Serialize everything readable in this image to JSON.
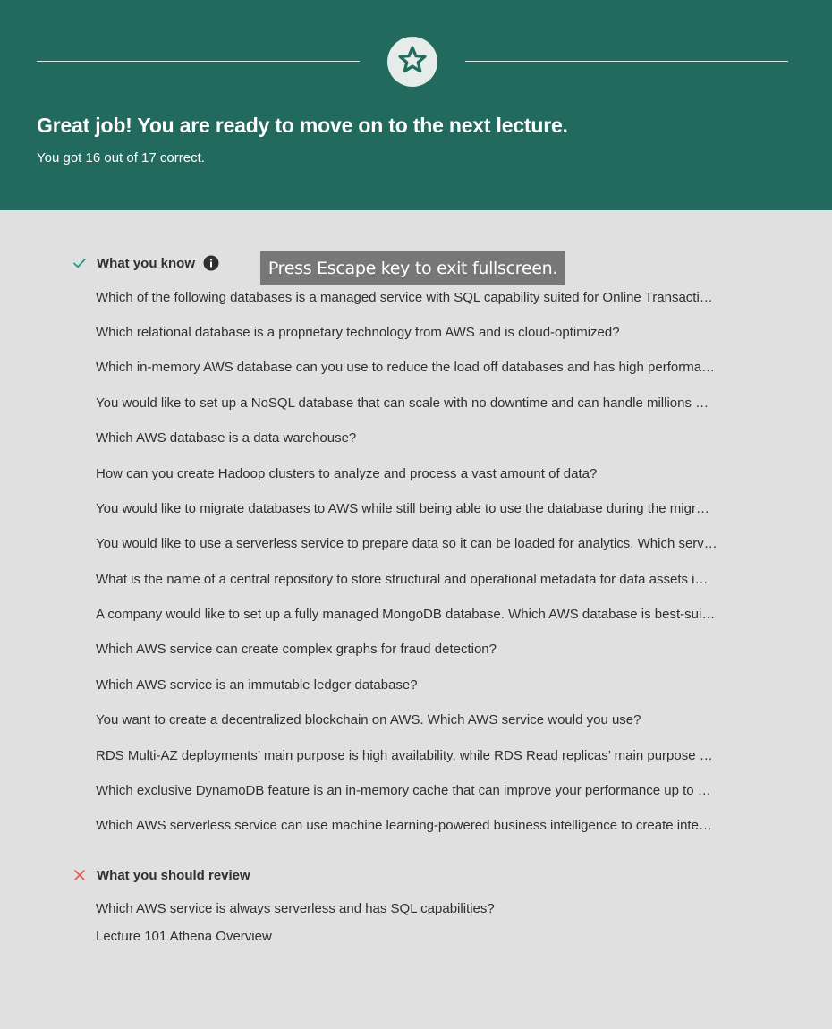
{
  "header": {
    "headline": "Great job! You are ready to move on to the next lecture.",
    "score_text": "You got 16 out of 17 correct.",
    "badge_icon": "star-icon",
    "background_color": "#226a5e"
  },
  "known_section": {
    "title": "What you know",
    "mark_icon": "check-icon",
    "info_icon": "info-icon",
    "questions": [
      "Which of the following databases is a managed service with SQL capability suited for Online Transacti…",
      "Which relational database is a proprietary technology from AWS and is cloud-optimized?",
      "Which in-memory AWS database can you use to reduce the load off databases and has high performa…",
      "You would like to set up a NoSQL database that can scale with no downtime and can handle millions …",
      "Which AWS database is a data warehouse?",
      "How can you create Hadoop clusters to analyze and process a vast amount of data?",
      "You would like to migrate databases to AWS while still being able to use the database during the migr…",
      "You would like to use a serverless service to prepare data so it can be loaded for analytics. Which serv…",
      "What is the name of a central repository to store structural and operational metadata for data assets i…",
      "A company would like to set up a fully managed MongoDB database. Which AWS database is best-sui…",
      "Which AWS service can create complex graphs for fraud detection?",
      "Which AWS service is an immutable ledger database?",
      "You want to create a decentralized blockchain on AWS. Which AWS service would you use?",
      "RDS Multi-AZ deployments’ main purpose is high availability, while RDS Read replicas’ main purpose …",
      "Which exclusive DynamoDB feature is an in-memory cache that can improve your performance up to …",
      "Which AWS serverless service can use machine learning-powered business intelligence to create inte…"
    ]
  },
  "review_section": {
    "title": "What you should review",
    "mark_icon": "x-icon",
    "questions": [
      "Which AWS service is always serverless and has SQL capabilities?"
    ],
    "lecture_link": "Lecture 101 Athena Overview"
  },
  "fullscreen_toast": "Press Escape key to exit fullscreen.",
  "colors": {
    "success": "#1e9e82",
    "error": "#e2584c",
    "text": "#2d2f31",
    "page_background": "#e0e0e0"
  }
}
